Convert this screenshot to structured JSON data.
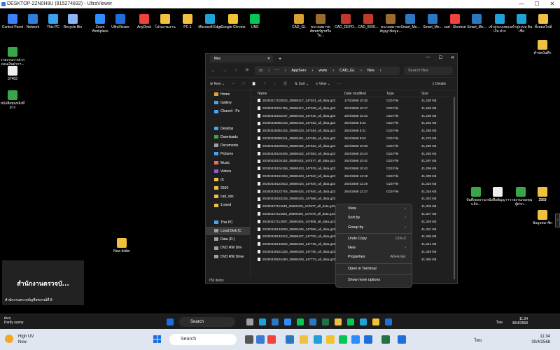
{
  "app": {
    "title": "DESKTOP-22N0H9U (815274832) - UltraViewer"
  },
  "desktop": {
    "top_icons": [
      {
        "label": "Control Panel",
        "color": "#3b82f6"
      },
      {
        "label": "Network",
        "color": "#2f7fd8"
      },
      {
        "label": "This PC",
        "color": "#3aa0f0"
      },
      {
        "label": "Recycle Bin",
        "color": "#8ab4f8"
      },
      {
        "label": "Zoom Workplace",
        "color": "#2d8cff"
      },
      {
        "label": "UltraViewer",
        "color": "#1e6fd9"
      },
      {
        "label": "AnyDesk",
        "color": "#ef443b"
      },
      {
        "label": "โปรแกรมงาน",
        "color": "#f0c040"
      },
      {
        "label": "PC-1",
        "color": "#f0c040"
      },
      {
        "label": "Microsoft Edge",
        "color": "#1fa2d8"
      },
      {
        "label": "Google Chrome",
        "color": "#f2c230"
      },
      {
        "label": "LINE",
        "color": "#06c755"
      }
    ],
    "top_right_icons": [
      {
        "label": "CAD_GL",
        "color": "#d9a032"
      },
      {
        "label": "ขนาดสมารท ศัพทหรัฐฯหรือใน...",
        "color": "#9b6b2e"
      },
      {
        "label": "CAD_DEPO...",
        "color": "#c0392b"
      },
      {
        "label": "CAD_INVE...",
        "color": "#c0392b"
      },
      {
        "label": "ขนาดสมารท สัญญาข้อมูล...",
        "color": "#9b6b2e"
      },
      {
        "label": "Smart_Me...",
        "color": "#2b78c2"
      },
      {
        "label": "Smart_Me...",
        "color": "#2b78c2"
      },
      {
        "label": "cad - Shortcut",
        "color": "#ef443b"
      },
      {
        "label": "Smart_Me...",
        "color": "#2b78c2"
      },
      {
        "label": "เข้าสู่ระบบของเงิน ฝาก",
        "color": "#1fa2d8"
      },
      {
        "label": "เข้าสู่ระบบ สินเชื่อ",
        "color": "#1fa2d8"
      },
      {
        "label": "ทั้งหมดไฟล์",
        "color": "#f0c040"
      }
    ],
    "left_icons": [
      {
        "label": "รายงานการฝาก ถอนเงินฝากฯ...",
        "color": "#3aa64a"
      },
      {
        "label": "37403",
        "color": "#eeeeee"
      },
      {
        "label": "หนังสือทุนขลิงที่ ฝาก",
        "color": "#3aa64a"
      }
    ],
    "right_icons": [
      {
        "label": "ทำจดบันทึก",
        "color": "#f0c040"
      }
    ],
    "mid_right_icons": [
      {
        "label": "บันทึกผลงาน แล็บ...",
        "color": "#3aa64a"
      },
      {
        "label": "หนังสือสัญญาฯ",
        "color": "#eeeeee"
      },
      {
        "label": "รายงานกองทุน ผู้ฝาก...",
        "color": "#3aa64a"
      },
      {
        "label": "2569",
        "color": "#f0c040"
      },
      {
        "label": "2569",
        "color": "#f0c040"
      }
    ],
    "far_right_bottom": {
      "label": "ข้อมูลสมาชิก",
      "color": "#f0c040"
    },
    "new_folder": {
      "label": "New folder",
      "color": "#f0c040"
    }
  },
  "explorer": {
    "tab": "files",
    "path": [
      "AppServ",
      "www",
      "CAD_GL",
      "files"
    ],
    "search_placeholder": "Search files",
    "cmd": {
      "new": "New",
      "sort": "Sort",
      "view": "View",
      "details": "Details"
    },
    "nav": [
      {
        "label": "Home",
        "color": "#e8a03a"
      },
      {
        "label": "Gallery",
        "color": "#4aa3f0"
      },
      {
        "label": "Chanvit - Pe",
        "color": "#4aa3f0"
      },
      {
        "label": "",
        "color": "transparent"
      },
      {
        "label": "Desktop",
        "color": "#4aa3f0"
      },
      {
        "label": "Downloads",
        "color": "#3aa64a"
      },
      {
        "label": "Documents",
        "color": "#9aa0a6"
      },
      {
        "label": "Pictures",
        "color": "#4aa3f0"
      },
      {
        "label": "Music",
        "color": "#ef6b5b"
      },
      {
        "label": "Videos",
        "color": "#8e5bd8"
      },
      {
        "label": "dc",
        "color": "#f0c040"
      },
      {
        "label": "2569",
        "color": "#f0c040"
      },
      {
        "label": "cad_vbs",
        "color": "#f0c040"
      },
      {
        "label": "1.word",
        "color": "#f0c040"
      },
      {
        "label": "",
        "color": "transparent"
      },
      {
        "label": "This PC",
        "color": "#4aa3f0"
      },
      {
        "label": "Local Disk (C",
        "color": "#9aa0a6"
      },
      {
        "label": "Data (D:)",
        "color": "#9aa0a6"
      },
      {
        "label": "DVD RW Driv",
        "color": "#9aa0a6"
      },
      {
        "label": "DVD RW Drive",
        "color": "#9aa0a6"
      }
    ],
    "columns": [
      "Name",
      "Date modified",
      "Type",
      "Size"
    ],
    "rows": [
      [
        "20250417103022_25680417_147401_all_data.g23",
        "17/4/2568 10:30",
        "G23 File",
        "41,230 KB"
      ],
      [
        "20250420101756_25680417_147409_all_data.g23",
        "20/4/2568 10:17",
        "G23 File",
        "41,256 KB"
      ],
      [
        "20250420102237_25680418_147430_all_data.g23",
        "20/4/2568 10:22",
        "G23 File",
        "41,236 KB"
      ],
      [
        "20250425083433_25680419_147452_all_data.g23",
        "25/4/2568 8:34",
        "G23 File",
        "41,262 KB"
      ],
      [
        "20250425084104_25680420_147464_all_data.g23",
        "25/4/2568 8:41",
        "G23 File",
        "41,265 KB"
      ],
      [
        "20250425085341_25680421_147489_all_data.g23",
        "25/4/2568 8:53",
        "G23 File",
        "41,275 KB"
      ],
      [
        "20250425100619_25680422_147532_all_data.g23",
        "25/4/2568 10:06",
        "G23 File",
        "41,290 KB"
      ],
      [
        "20250425102405_25680422_147553_all_data.g23",
        "25/4/2568 10:24",
        "G23 File",
        "41,293 KB"
      ],
      [
        "20250425104119_25680423_147577_all_data.g23",
        "25/4/2568 10:41",
        "G23 File",
        "41,297 KB"
      ],
      [
        "20250425104158_25680423_147578_all_data.g23",
        "25/4/2568 10:42",
        "G23 File",
        "41,299 KB"
      ],
      [
        "20250425121918_25680423_147610_all_data.g23",
        "25/4/2568 12:19",
        "G23 File",
        "41,309 KB"
      ],
      [
        "20250425122613_25680424_147640_all_data.g23",
        "25/4/2568 12:26",
        "G23 File",
        "41,316 KB"
      ],
      [
        "20250425122704_25680424_147640_all_data.g23",
        "25/4/2568 12:27",
        "G23 File",
        "41,316 KB"
      ],
      [
        "20250426153225_25680425_147666_all_data.g23",
        "",
        "",
        "41,323 KB"
      ],
      [
        "20250427111848_25680425_147677_all_data.g23",
        "",
        "",
        "41,326 KB"
      ],
      [
        "20250427111823_25680425_147678_all_data.g23",
        "",
        "",
        "41,327 KB"
      ],
      [
        "20250427112057_25680426_147686_all_data.g23",
        "",
        "",
        "41,329 KB"
      ],
      [
        "20250428145000_25680426_147696_all_data.g23",
        "",
        "",
        "41,331 KB"
      ],
      [
        "20250428145212_25680427_147700_all_data.g23",
        "",
        "",
        "41,336 KB"
      ],
      [
        "20250428145602_25680428_147728_all_data.g23",
        "",
        "",
        "41,341 KB"
      ],
      [
        "20250429151325_25680428_147750_all_data.g23",
        "",
        "",
        "41,348 KB"
      ],
      [
        "20250429152450_25680429_147773_all_data.g23",
        "",
        "",
        "41,355 KB"
      ]
    ],
    "status": "750 items"
  },
  "context_menu": {
    "view": "View",
    "sort_by": "Sort by",
    "group_by": "Group by",
    "undo": "Undo Copy",
    "undo_sc": "Ctrl+Z",
    "new": "New",
    "properties": "Properties",
    "properties_sc": "Alt+Enter",
    "terminal": "Open in Terminal",
    "more": "Show more options"
  },
  "notification": {
    "title": "สำนักงานตรวจบั...",
    "subtitle": "สำนักงานตรวจบัญชีสหกรณ์ที่ 8"
  },
  "remote_taskbar": {
    "weather_temp": "ฝนๆ",
    "weather_desc": "Partly sunny",
    "search": "Search",
    "lang": "ไทย",
    "time": "11:34",
    "date": "30/4/2568"
  },
  "local_taskbar": {
    "weather_temp": "High UV",
    "weather_desc": "Now",
    "search": "Search",
    "lang": "ไทย",
    "time": "11:34",
    "date": "30/4/2568"
  }
}
